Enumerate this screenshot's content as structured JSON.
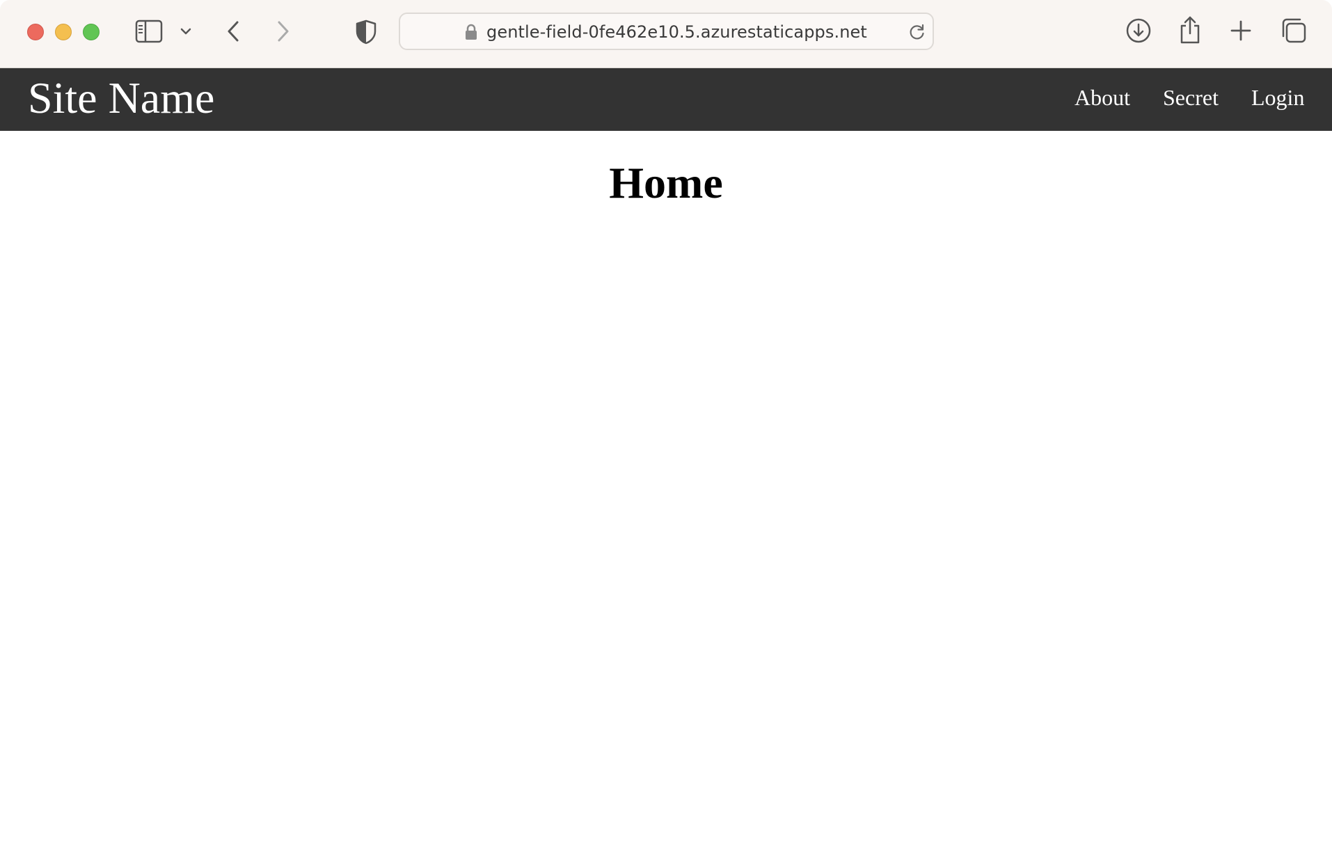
{
  "browser": {
    "url": "gentle-field-0fe462e10.5.azurestaticapps.net",
    "icons": [
      "sidebar-icon",
      "chevron-down-icon",
      "back-icon",
      "forward-icon",
      "shield-icon",
      "lock-icon",
      "reload-icon",
      "download-icon",
      "share-icon",
      "plus-icon",
      "tabs-icon"
    ]
  },
  "site": {
    "name": "Site Name",
    "nav": {
      "about": "About",
      "secret": "Secret",
      "login": "Login"
    },
    "nav_background": "#333333"
  },
  "main": {
    "heading": "Home"
  }
}
